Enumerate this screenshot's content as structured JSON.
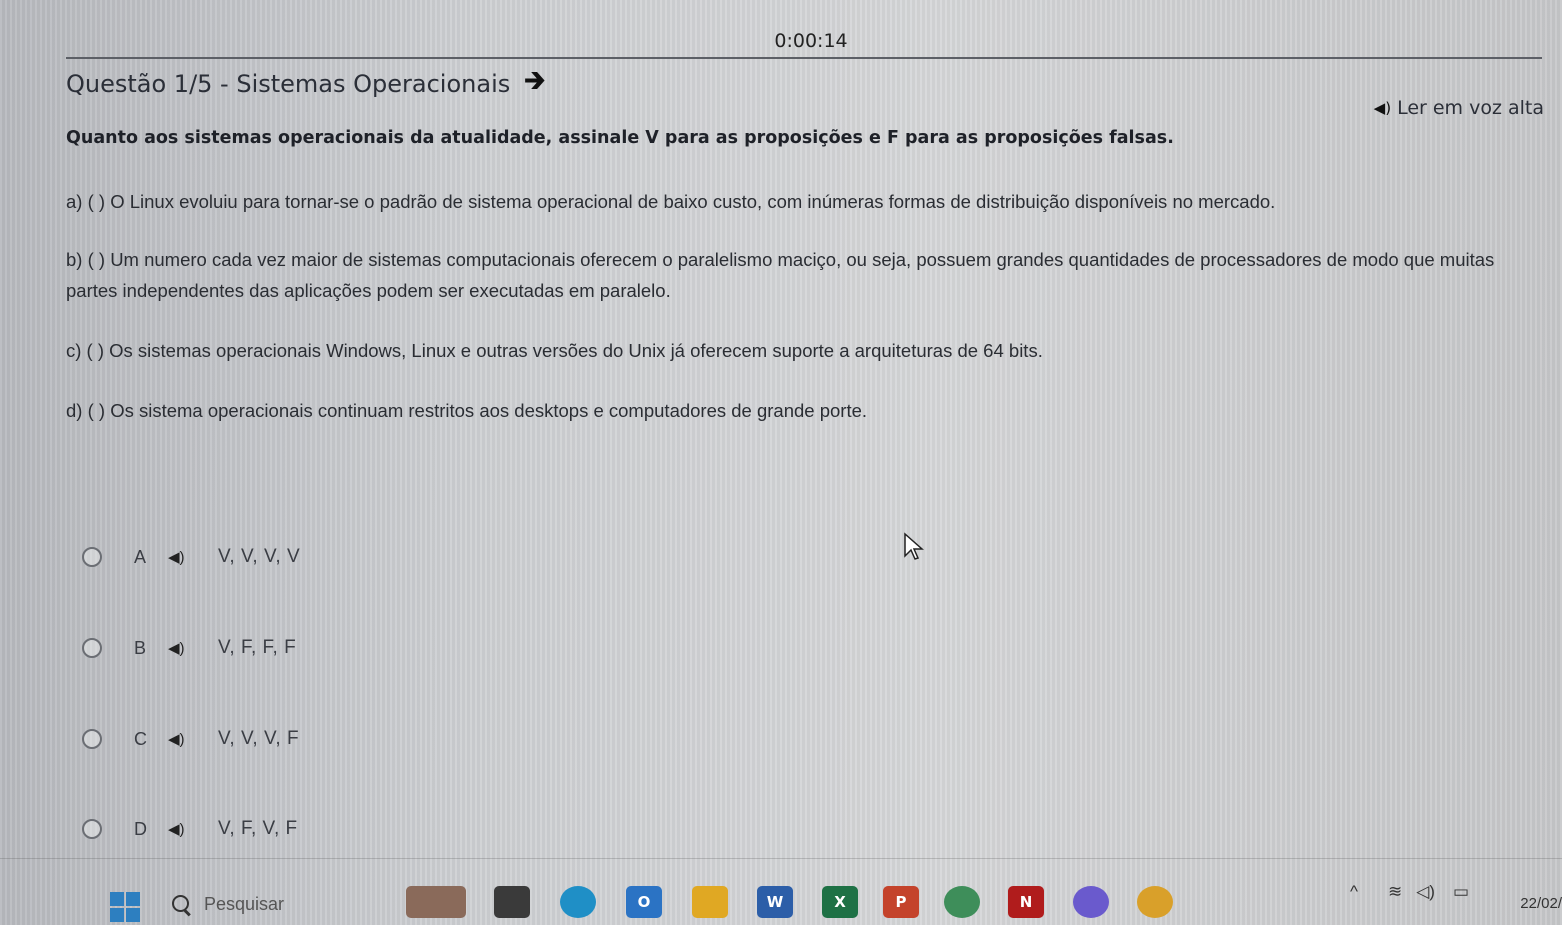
{
  "timer": "0:00:14",
  "header": {
    "title": "Questão 1/5 - Sistemas Operacionais",
    "next_arrow": "🡲"
  },
  "tts": {
    "label": "Ler em voz alta",
    "icon": "speaker-icon"
  },
  "question": {
    "statement": "Quanto aos sistemas operacionais da atualidade, assinale V para as proposições e F para as proposições falsas.",
    "propositions": [
      "a) ( ) O Linux evoluiu para tornar-se o padrão de sistema operacional de baixo custo, com inúmeras formas de distribuição disponíveis no mercado.",
      "b) ( ) Um numero cada vez maior de sistemas computacionais oferecem o paralelismo maciço, ou seja, possuem grandes quantidades de processadores de modo que muitas partes independentes das aplicações podem ser executadas em paralelo.",
      "c) ( ) Os sistemas operacionais Windows, Linux e outras versões do Unix já oferecem suporte a arquiteturas de 64 bits.",
      "d) ( ) Os sistema operacionais continuam restritos aos desktops e computadores de grande porte."
    ]
  },
  "options": [
    {
      "letter": "A",
      "text": "V, V, V, V"
    },
    {
      "letter": "B",
      "text": "V, F, F, F"
    },
    {
      "letter": "C",
      "text": "V, V, V, F"
    },
    {
      "letter": "D",
      "text": "V, F, V, F"
    }
  ],
  "taskbar": {
    "search_placeholder": "Pesquisar",
    "apps": [
      {
        "name": "news-widget-icon",
        "color": "#8a6a5a",
        "label": ""
      },
      {
        "name": "file-explorer-icon",
        "color": "#3a3a3a",
        "label": ""
      },
      {
        "name": "edge-icon",
        "color": "#1f8fc6",
        "label": ""
      },
      {
        "name": "outlook-icon",
        "color": "#2b73c4",
        "label": "O"
      },
      {
        "name": "folder-icon",
        "color": "#e0a823",
        "label": ""
      },
      {
        "name": "word-icon",
        "color": "#2c5ea8",
        "label": "W"
      },
      {
        "name": "excel-icon",
        "color": "#1e7145",
        "label": "X"
      },
      {
        "name": "powerpoint-icon",
        "color": "#c4432b",
        "label": "P"
      },
      {
        "name": "whatsapp-icon",
        "color": "#3e8e5a",
        "label": ""
      },
      {
        "name": "netflix-icon",
        "color": "#b01c1c",
        "label": "N"
      },
      {
        "name": "copilot-icon",
        "color": "#6a5acd",
        "label": ""
      },
      {
        "name": "chrome-icon",
        "color": "#d9a02a",
        "label": ""
      }
    ],
    "date": "22/02/"
  }
}
